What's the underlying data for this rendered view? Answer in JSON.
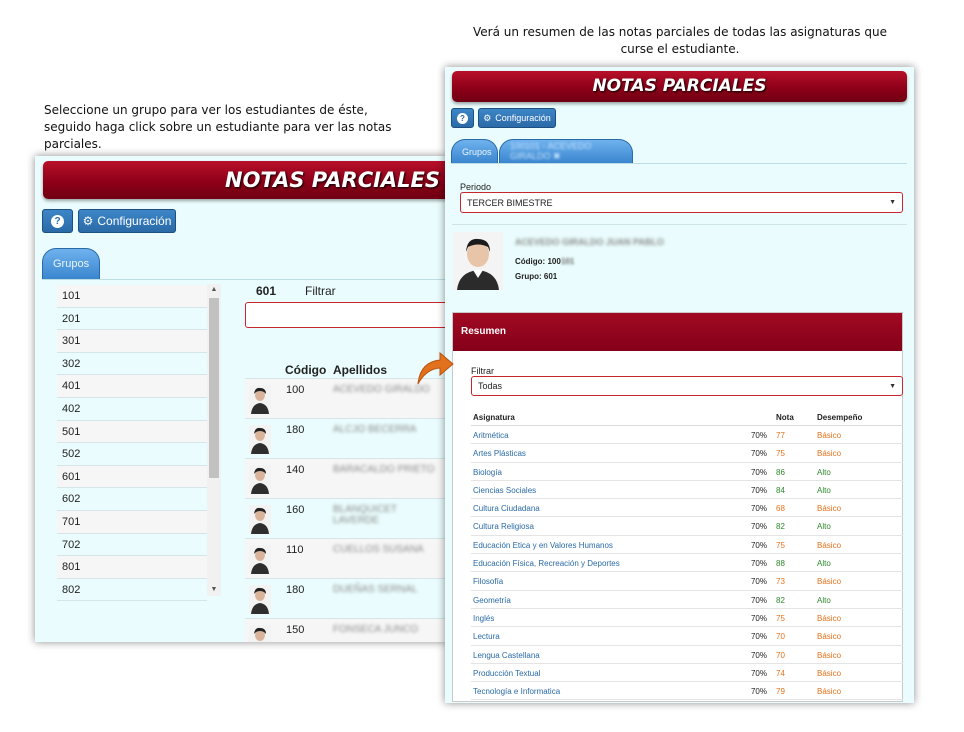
{
  "captions": {
    "left": "Seleccione un grupo para ver los estudiantes de éste, seguido haga click sobre un estudiante para ver las notas parciales.",
    "right": "Verá un resumen de las notas parciales de todas las asignaturas que curse el estudiante."
  },
  "app": {
    "title": "NOTAS PARCIALES",
    "help_label": "?",
    "config_label": "Configuración",
    "config_icon": "gear-icon",
    "help_icon": "question-circle-icon"
  },
  "colors": {
    "banner": "#8e0018",
    "button": "#2a6aa7",
    "panel_bg": "#eafcfd",
    "basico": "#e8711a",
    "alto": "#2d8a2b",
    "input_border": "#c9252c"
  },
  "left_panel": {
    "tab_label": "Grupos",
    "groups": [
      "101",
      "201",
      "301",
      "302",
      "401",
      "402",
      "501",
      "502",
      "601",
      "602",
      "701",
      "702",
      "801",
      "802"
    ],
    "selected_group": "601",
    "filter_label": "Filtrar",
    "filter_value": "",
    "columns": {
      "codigo": "Código",
      "apellidos": "Apellidos"
    },
    "students": [
      {
        "code": "100",
        "hidden": "ACEVEDO GIRALDO"
      },
      {
        "code": "180",
        "hidden": "ALCJO BECERRA"
      },
      {
        "code": "140",
        "hidden": "BARACALDO PRIETO"
      },
      {
        "code": "160",
        "hidden": "BLANQUICET LAVERDE"
      },
      {
        "code": "110",
        "hidden": "CUELLOS SUSANA"
      },
      {
        "code": "180",
        "hidden": "DUEÑAS SERNAL"
      },
      {
        "code": "150",
        "hidden": "FONSECA JUNCO"
      }
    ]
  },
  "right_panel": {
    "tabs": {
      "groups": "Grupos",
      "student": "100101 - ACEVEDO GIRALDO ✖"
    },
    "period_label": "Periodo",
    "period_value": "TERCER BIMESTRE",
    "student": {
      "name": "ACEVEDO GIRALDO JUAN PABLO",
      "code_label": "Código:",
      "code_value": "100",
      "code_hidden": "101",
      "group_label": "Grupo:",
      "group_value": "601"
    },
    "summary_title": "Resumen",
    "filter_label": "Filtrar",
    "filter_value": "Todas",
    "table_headers": {
      "asignatura": "Asignatura",
      "nota": "Nota",
      "desempeno": "Desempeño"
    },
    "rows": [
      {
        "asignatura": "Aritmética",
        "pct": "70%",
        "nota": "77",
        "des": "Básico"
      },
      {
        "asignatura": "Artes Plásticas",
        "pct": "70%",
        "nota": "75",
        "des": "Básico"
      },
      {
        "asignatura": "Biología",
        "pct": "70%",
        "nota": "86",
        "des": "Alto"
      },
      {
        "asignatura": "Ciencias Sociales",
        "pct": "70%",
        "nota": "84",
        "des": "Alto"
      },
      {
        "asignatura": "Cultura Ciudadana",
        "pct": "70%",
        "nota": "68",
        "des": "Básico"
      },
      {
        "asignatura": "Cultura Religiosa",
        "pct": "70%",
        "nota": "82",
        "des": "Alto"
      },
      {
        "asignatura": "Educación Etica y en Valores Humanos",
        "pct": "70%",
        "nota": "75",
        "des": "Básico"
      },
      {
        "asignatura": "Educación Física, Recreación y Deportes",
        "pct": "70%",
        "nota": "88",
        "des": "Alto"
      },
      {
        "asignatura": "Filosofía",
        "pct": "70%",
        "nota": "73",
        "des": "Básico"
      },
      {
        "asignatura": "Geometría",
        "pct": "70%",
        "nota": "82",
        "des": "Alto"
      },
      {
        "asignatura": "Inglés",
        "pct": "70%",
        "nota": "75",
        "des": "Básico"
      },
      {
        "asignatura": "Lectura",
        "pct": "70%",
        "nota": "70",
        "des": "Básico"
      },
      {
        "asignatura": "Lengua Castellana",
        "pct": "70%",
        "nota": "70",
        "des": "Básico"
      },
      {
        "asignatura": "Producción Textual",
        "pct": "70%",
        "nota": "74",
        "des": "Básico"
      },
      {
        "asignatura": "Tecnología e Informatica",
        "pct": "70%",
        "nota": "79",
        "des": "Básico"
      }
    ]
  }
}
